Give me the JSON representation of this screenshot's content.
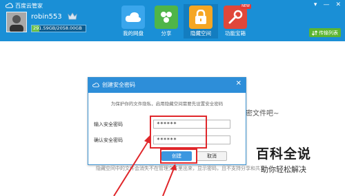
{
  "app": {
    "title": "百度云管家",
    "window_controls": [
      "▾",
      "—",
      "✕"
    ]
  },
  "user": {
    "name": "robin553",
    "storage": "291.59GB/2058.00GB",
    "storage_used_fraction": 0.14
  },
  "nav": {
    "items": [
      {
        "label": "我的网盘",
        "icon": "cloud-icon"
      },
      {
        "label": "分享",
        "icon": "share-icon"
      },
      {
        "label": "隐藏空间",
        "icon": "lock-icon",
        "active": true
      },
      {
        "label": "功能宝箱",
        "icon": "toolbox-icon",
        "badge": "NEW"
      }
    ],
    "transfer_button": "传输列表"
  },
  "background": {
    "partial_text": "密文件吧~",
    "bottom_line": "隐藏空间中的文件会消失不在管理文件里出来，显示密码，且不支持分享和共享"
  },
  "dialog": {
    "title": "创建安全密码",
    "description": "为保护你的文件隐私，启用隐藏空间需要先设置安全密码",
    "fields": [
      {
        "label": "输入安全密码",
        "value": "******"
      },
      {
        "label": "确认安全密码",
        "value": "******"
      }
    ],
    "create_button": "创建",
    "cancel_button": "取消",
    "close_symbol": "✕"
  },
  "watermark": {
    "title": "百科全说",
    "subtitle": "助你轻松解决"
  },
  "colors": {
    "topbar": "#1a8fd6",
    "highlight": "#e0262a",
    "accent_green": "#5cb531"
  }
}
